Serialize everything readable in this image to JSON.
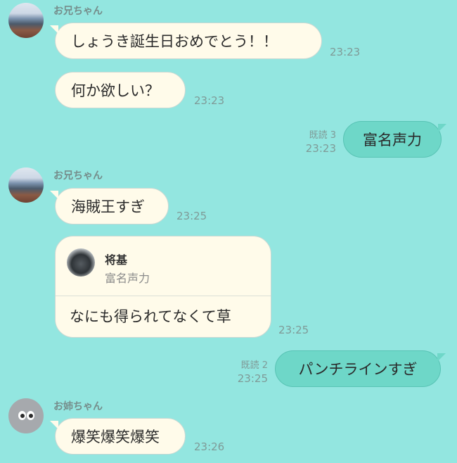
{
  "messages": [
    {
      "sender": "お兄ちゃん",
      "text": "しょうき誕生日おめでとう！！",
      "time": "23:23"
    },
    {
      "text": "何か欲しい？",
      "time": "23:23"
    },
    {
      "text": "富名声力",
      "read": "既読 3",
      "time": "23:23"
    },
    {
      "sender": "お兄ちゃん",
      "text": "海賊王すぎ",
      "time": "23:25"
    },
    {
      "reply_title": "将基",
      "reply_quote": "富名声力",
      "text": "なにも得られてなくて草",
      "time": "23:25"
    },
    {
      "text": "パンチラインすぎ",
      "read": "既読 2",
      "time": "23:25"
    },
    {
      "sender": "お姉ちゃん",
      "text": "爆笑爆笑爆笑",
      "time": "23:26"
    }
  ],
  "colors": {
    "background": "#93e6e0",
    "incoming_bubble": "#fffbea",
    "outgoing_bubble": "#6ed7c8"
  },
  "icons": {
    "avatar_1": "profile-photo",
    "avatar_2": "profile-photo",
    "avatar_3": "default-eyes-avatar"
  }
}
